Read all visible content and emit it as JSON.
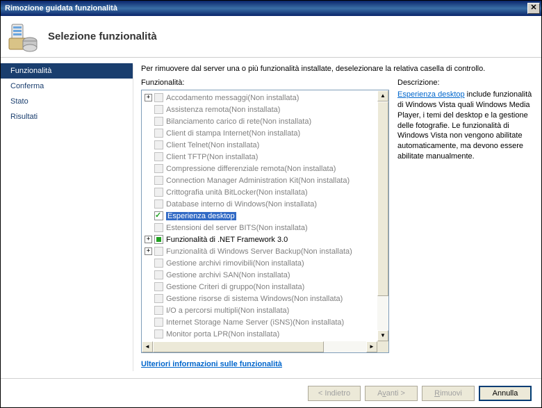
{
  "window": {
    "title": "Rimozione guidata funzionalità"
  },
  "header": {
    "title": "Selezione funzionalità"
  },
  "sidebar": {
    "items": [
      {
        "label": "Funzionalità",
        "active": true
      },
      {
        "label": "Conferma",
        "active": false
      },
      {
        "label": "Stato",
        "active": false
      },
      {
        "label": "Risultati",
        "active": false
      }
    ]
  },
  "main": {
    "instruction": "Per rimuovere dal server una o più funzionalità installate, deselezionare la relativa casella di controllo.",
    "features_label": "Funzionalità:",
    "description_label": "Descrizione:",
    "more_link": "Ulteriori informazioni sulle funzionalità"
  },
  "tree": [
    {
      "label": "Accodamento messaggi",
      "suffix": "(Non installata)",
      "expandable": true,
      "disabled": true
    },
    {
      "label": "Assistenza remota",
      "suffix": "(Non installata)",
      "disabled": true
    },
    {
      "label": "Bilanciamento carico di rete",
      "suffix": "(Non installata)",
      "disabled": true
    },
    {
      "label": "Client di stampa Internet",
      "suffix": "(Non installata)",
      "disabled": true
    },
    {
      "label": "Client Telnet",
      "suffix": "(Non installata)",
      "disabled": true
    },
    {
      "label": "Client TFTP",
      "suffix": "(Non installata)",
      "disabled": true
    },
    {
      "label": "Compressione differenziale remota",
      "suffix": "(Non installata)",
      "disabled": true
    },
    {
      "label": "Connection Manager Administration Kit",
      "suffix": "(Non installata)",
      "disabled": true
    },
    {
      "label": "Crittografia unità BitLocker",
      "suffix": "(Non installata)",
      "disabled": true
    },
    {
      "label": "Database interno di Windows",
      "suffix": "(Non installata)",
      "disabled": true
    },
    {
      "label": "Esperienza desktop",
      "suffix": "",
      "checked": true,
      "selected": true
    },
    {
      "label": "Estensioni del server BITS",
      "suffix": "(Non installata)",
      "disabled": true
    },
    {
      "label": "Funzionalità di .NET Framework 3.0",
      "suffix": "",
      "expandable": true,
      "indet": true
    },
    {
      "label": "Funzionalità di Windows Server Backup",
      "suffix": "(Non installata)",
      "expandable": true,
      "disabled": true
    },
    {
      "label": "Gestione archivi rimovibili",
      "suffix": "(Non installata)",
      "disabled": true
    },
    {
      "label": "Gestione archivi SAN",
      "suffix": "(Non installata)",
      "disabled": true
    },
    {
      "label": "Gestione Criteri di gruppo",
      "suffix": "(Non installata)",
      "disabled": true
    },
    {
      "label": "Gestione risorse di sistema Windows",
      "suffix": "(Non installata)",
      "disabled": true
    },
    {
      "label": "I/O a percorsi multipli",
      "suffix": "(Non installata)",
      "disabled": true
    },
    {
      "label": "Internet Storage Name Server (iSNS)",
      "suffix": "(Non installata)",
      "disabled": true
    },
    {
      "label": "Monitor porta LPR",
      "suffix": "(Non installata)",
      "disabled": true
    }
  ],
  "description": {
    "link_text": "Esperienza desktop",
    "body": " include funzionalità di Windows Vista quali Windows Media Player, i temi del desktop e la gestione delle fotografie. Le funzionalità di Windows Vista non vengono abilitate automaticamente, ma devono essere abilitate manualmente."
  },
  "footer": {
    "back": "< Indietro",
    "next_pre": "A",
    "next_u": "v",
    "next_post": "anti >",
    "remove_pre": "",
    "remove_u": "R",
    "remove_post": "imuovi",
    "cancel": "Annulla"
  }
}
